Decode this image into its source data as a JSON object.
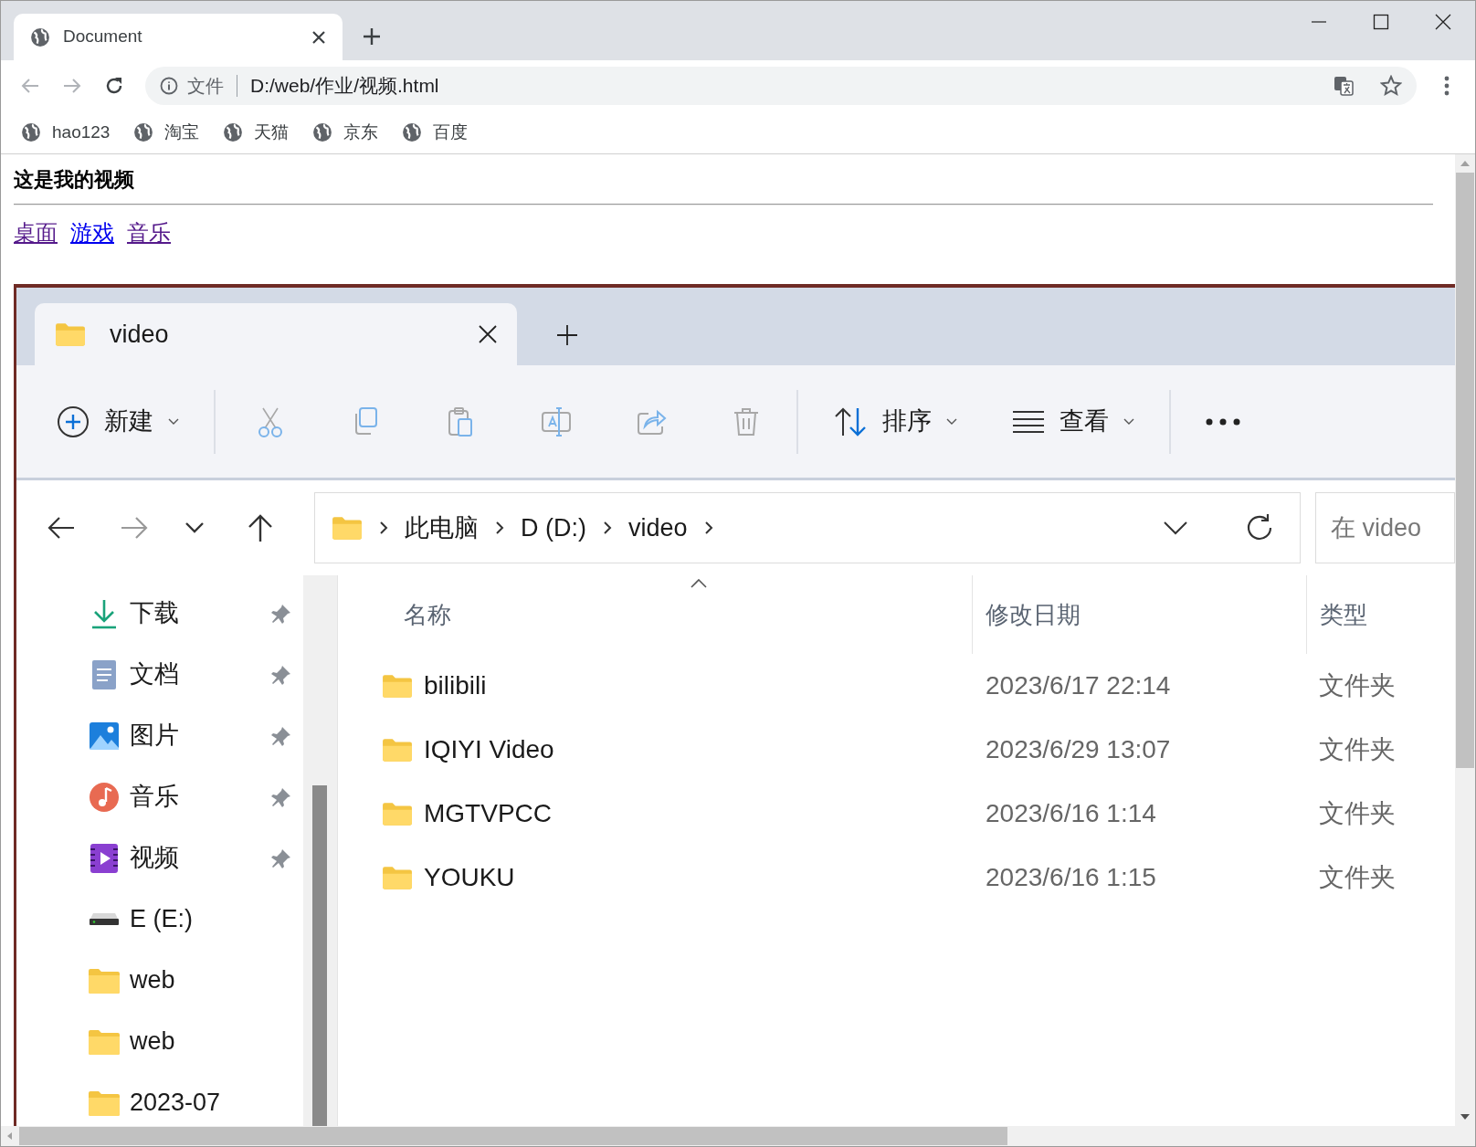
{
  "browser": {
    "tab": {
      "title": "Document"
    },
    "address": {
      "scheme_label": "文件",
      "url": "D:/web/作业/视频.html"
    },
    "bookmarks": [
      "hao123",
      "淘宝",
      "天猫",
      "京东",
      "百度"
    ]
  },
  "page": {
    "heading": "这是我的视频",
    "links": [
      {
        "label": "桌面",
        "visited": true
      },
      {
        "label": "游戏",
        "visited": false
      },
      {
        "label": "音乐",
        "visited": true
      }
    ],
    "explorer": {
      "tab": {
        "title": "video"
      },
      "toolbar": {
        "new": "新建",
        "sort": "排序",
        "view": "查看"
      },
      "breadcrumb": [
        "此电脑",
        "D (D:)",
        "video"
      ],
      "search": {
        "placeholder": "在 video"
      },
      "nav_items": [
        {
          "label": "下载",
          "kind": "download",
          "pinned": true
        },
        {
          "label": "文档",
          "kind": "document",
          "pinned": true
        },
        {
          "label": "图片",
          "kind": "pictures",
          "pinned": true
        },
        {
          "label": "音乐",
          "kind": "music",
          "pinned": true
        },
        {
          "label": "视频",
          "kind": "videos",
          "pinned": true
        },
        {
          "label": "E (E:)",
          "kind": "drive",
          "pinned": false
        },
        {
          "label": "web",
          "kind": "folder",
          "pinned": false
        },
        {
          "label": "web",
          "kind": "folder",
          "pinned": false
        },
        {
          "label": "2023-07",
          "kind": "folder",
          "pinned": false
        }
      ],
      "columns": [
        {
          "label": "名称",
          "sorted": true
        },
        {
          "label": "修改日期",
          "sorted": false
        },
        {
          "label": "类型",
          "sorted": false
        }
      ],
      "rows": [
        {
          "name": "bilibili",
          "modified": "2023/6/17 22:14",
          "type": "文件夹"
        },
        {
          "name": "IQIYI Video",
          "modified": "2023/6/29 13:07",
          "type": "文件夹"
        },
        {
          "name": "MGTVPCC",
          "modified": "2023/6/16 1:14",
          "type": "文件夹"
        },
        {
          "name": "YOUKU",
          "modified": "2023/6/16 1:15",
          "type": "文件夹"
        }
      ]
    }
  }
}
